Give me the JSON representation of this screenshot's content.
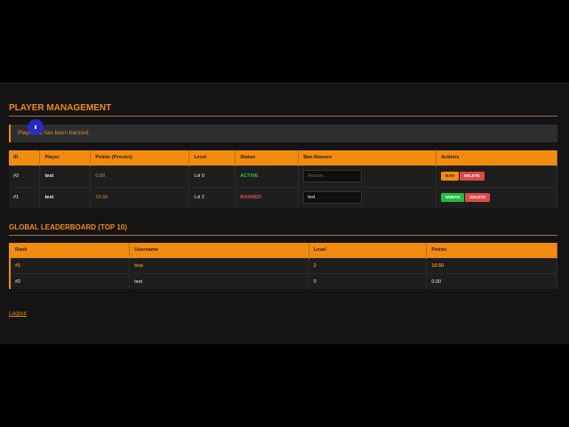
{
  "title": "PLAYER MANAGEMENT",
  "alert": "Player #1 has been banned.",
  "players": {
    "headers": [
      "ID",
      "Player",
      "Points (Precise)",
      "Level",
      "Status",
      "Ban Reason",
      "Actions"
    ],
    "rows": [
      {
        "id": "#2",
        "player": "test",
        "points": "0.00",
        "level": "Lvl 0",
        "status": "ACTIVE",
        "reason_value": "",
        "reason_placeholder": "Reason...",
        "action": "BAN",
        "delete": "DELETE"
      },
      {
        "id": "#1",
        "player": "test",
        "points": "10.50",
        "level": "Lvl 2",
        "status": "BANNED",
        "reason_value": "test",
        "reason_placeholder": "Reason...",
        "action": "UNBAN",
        "delete": "DELETE"
      }
    ]
  },
  "leaderboard": {
    "title": "GLOBAL LEADERBOARD (TOP 10)",
    "headers": [
      "Rank",
      "Username",
      "Level",
      "Points"
    ],
    "rows": [
      {
        "rank": "#1",
        "username": "test",
        "level": "2",
        "points": "10.50"
      },
      {
        "rank": "#2",
        "username": "test",
        "level": "0",
        "points": "0.00"
      }
    ]
  },
  "logout": "Logout",
  "colors": {
    "accent": "#f28c0f",
    "active": "#22cc44",
    "banned": "#e04848"
  }
}
